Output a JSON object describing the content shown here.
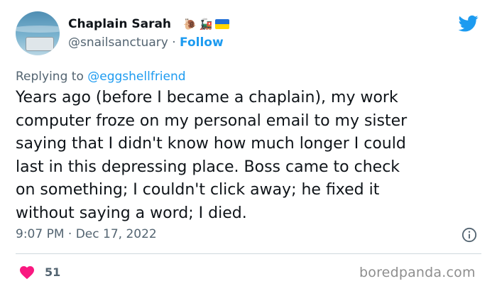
{
  "author": {
    "name": "Chaplain Sarah",
    "emojis": [
      "🐌",
      "🚂"
    ],
    "handle": "@snailsanctuary",
    "separator": "·",
    "follow_label": "Follow"
  },
  "reply": {
    "prefix": "Replying to",
    "mention": "@eggshellfriend"
  },
  "tweet": {
    "text": "Years ago (before I became a chaplain), my work\ncomputer froze on my personal email to my sister\nsaying that I didn't know how much longer I could\nlast in this depressing place. Boss came to check\non something; I couldn't click away; he fixed it\nwithout saying a word; I died.",
    "timestamp": "9:07 PM · Dec 17, 2022"
  },
  "engagement": {
    "like_count": "51"
  },
  "watermark": "boredpanda.com",
  "icons": {
    "brand": "twitter-bird-icon",
    "info": "info-icon",
    "like": "heart-icon"
  },
  "colors": {
    "accent": "#1d9bf0",
    "text": "#0f1419",
    "muted": "#536471",
    "like": "#f91880",
    "divider": "#cfd9de",
    "watermark": "#8e8e8e"
  }
}
